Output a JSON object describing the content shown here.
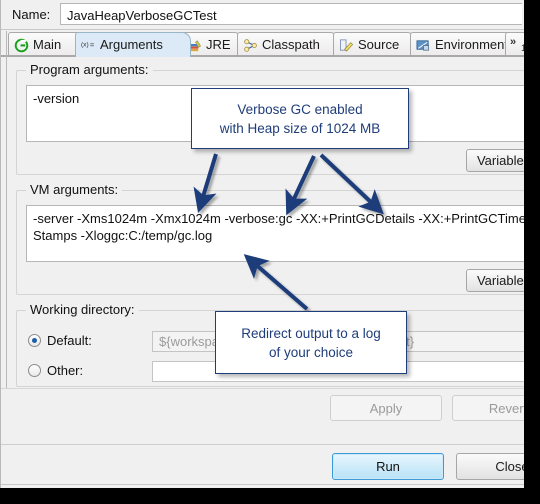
{
  "window": {
    "name_label": "Name:",
    "name_value": "JavaHeapVerboseGCTest"
  },
  "tabs": [
    {
      "label": "Main",
      "icon": "main-circle-icon",
      "active": false
    },
    {
      "label": "Arguments",
      "icon": "arguments-xequals-icon",
      "active": true
    },
    {
      "label": "JRE",
      "icon": "jre-books-icon",
      "active": false
    },
    {
      "label": "Classpath",
      "icon": "classpath-icon",
      "active": false
    },
    {
      "label": "Source",
      "icon": "source-pencil-icon",
      "active": false
    },
    {
      "label": "Environment",
      "icon": "environment-icon",
      "active": false
    }
  ],
  "tab_overflow": {
    "chevron": "»",
    "count": "1"
  },
  "program_arguments": {
    "title": "Program arguments:",
    "value": "-version",
    "variables_button": "Variables..."
  },
  "vm_arguments": {
    "title": "VM arguments:",
    "value": "-server -Xms1024m -Xmx1024m -verbose:gc -XX:+PrintGCDetails -XX:+PrintGCTimeStamps -Xloggc:C:/temp/gc.log",
    "variables_button": "Variables..."
  },
  "working_directory": {
    "title": "Working directory:",
    "default_label": "Default:",
    "default_selected": true,
    "default_value": "${workspace_loc:JavaHeapVerboseGCTest}",
    "other_label": "Other:",
    "other_selected": false,
    "other_value": ""
  },
  "footer": {
    "apply_label": "Apply",
    "revert_label": "Revert",
    "run_label": "Run",
    "close_label": "Close"
  },
  "annotations": [
    {
      "id": "callout-heap",
      "line1": "Verbose GC enabled",
      "line2": "with Heap size of 1024 MB"
    },
    {
      "id": "callout-log",
      "line1": "Redirect output to a log",
      "line2": "of your choice"
    }
  ],
  "colors": {
    "annotation": "#1f3d7a",
    "tab_active": "#dbeaf6",
    "default_button": "#b8e2f7"
  }
}
